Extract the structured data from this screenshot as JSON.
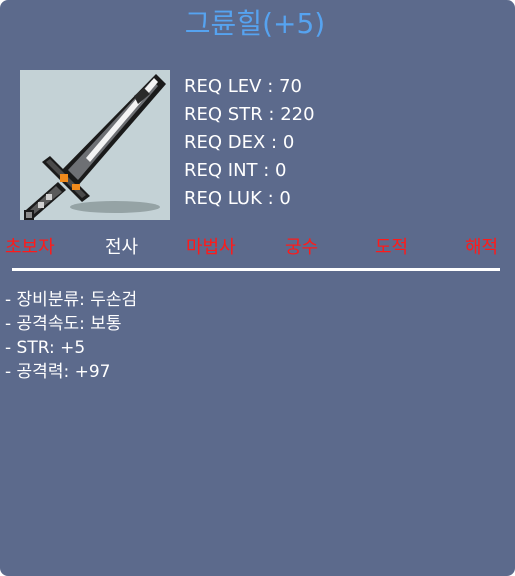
{
  "item": {
    "name": "그륜힐(+5)",
    "icon": "two-handed-sword-icon"
  },
  "requirements": [
    "REQ LEV : 70",
    "REQ STR : 220",
    "REQ DEX : 0",
    "REQ INT : 0",
    "REQ LUK : 0"
  ],
  "jobs": [
    {
      "label": "초보자",
      "allowed": false
    },
    {
      "label": "전사",
      "allowed": true
    },
    {
      "label": "마법사",
      "allowed": false
    },
    {
      "label": "궁수",
      "allowed": false
    },
    {
      "label": "도적",
      "allowed": false
    },
    {
      "label": "해적",
      "allowed": false
    }
  ],
  "stats": [
    "- 장비분류: 두손검",
    "- 공격속도: 보통",
    "- STR: +5",
    "- 공격력: +97"
  ],
  "colors": {
    "background": "#5c6a8c",
    "title": "#56a3f0",
    "allowed": "#ffffff",
    "restricted": "#ff1a1a"
  }
}
